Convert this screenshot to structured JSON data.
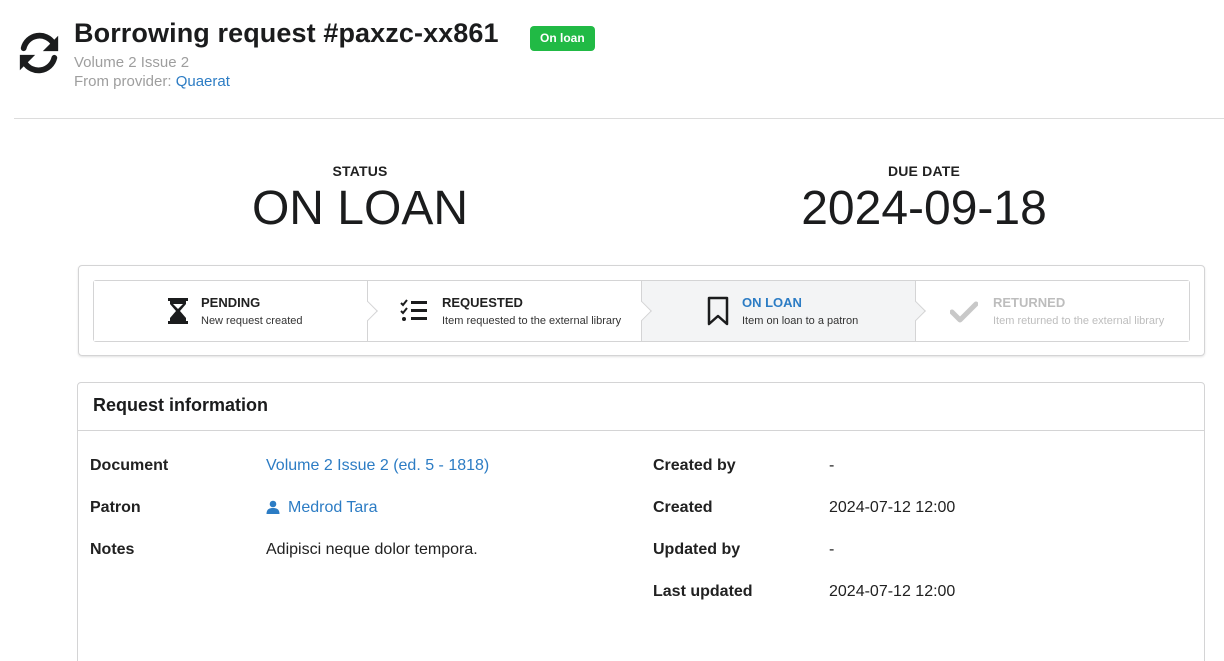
{
  "header": {
    "icon": "sync-icon",
    "title": "Borrowing request #paxzc-xx861",
    "badge": "On loan",
    "badge_color": "#21ba45",
    "subtitle": "Volume 2 Issue 2",
    "provider_label": "From provider:",
    "provider_name": "Quaerat"
  },
  "stats": {
    "status_label": "STATUS",
    "status_value": "ON LOAN",
    "due_label": "DUE DATE",
    "due_value": "2024-09-18"
  },
  "steps": [
    {
      "icon": "hourglass-icon",
      "title": "PENDING",
      "desc": "New request created",
      "state": "completed"
    },
    {
      "icon": "checklist-icon",
      "title": "REQUESTED",
      "desc": "Item requested to the external library",
      "state": "completed"
    },
    {
      "icon": "bookmark-icon",
      "title": "ON LOAN",
      "desc": "Item on loan to a patron",
      "state": "active"
    },
    {
      "icon": "check-icon",
      "title": "RETURNED",
      "desc": "Item returned to the external library",
      "state": "disabled"
    }
  ],
  "info": {
    "heading": "Request information",
    "left": [
      {
        "label": "Document",
        "value": "Volume 2 Issue 2 (ed. 5 - 1818)"
      },
      {
        "label": "Patron",
        "value": "Medrod Tara"
      },
      {
        "label": "Notes",
        "value": "Adipisci neque dolor tempora."
      }
    ],
    "right": [
      {
        "label": "Created by",
        "value": "-"
      },
      {
        "label": "Created",
        "value": "2024-07-12 12:00"
      },
      {
        "label": "Updated by",
        "value": "-"
      },
      {
        "label": "Last updated",
        "value": "2024-07-12 12:00"
      }
    ]
  },
  "colors": {
    "link": "#2c7cc4",
    "active_step_bg": "#f3f4f5",
    "disabled_text": "#bdbdbd"
  }
}
